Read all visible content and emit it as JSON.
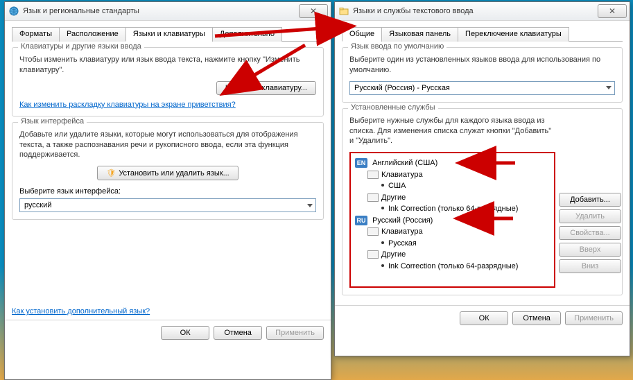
{
  "left": {
    "title": "Язык и региональные стандарты",
    "tabs": [
      "Форматы",
      "Расположение",
      "Языки и клавиатуры",
      "Дополнительно"
    ],
    "active_tab": 2,
    "group1": {
      "legend": "Клавиатуры и другие языки ввода",
      "desc": "Чтобы изменить клавиатуру или язык ввода текста, нажмите кнопку \"Изменить клавиатуру\".",
      "btn": "Изменить клавиатуру...",
      "link": "Как изменить раскладку клавиатуры на экране приветствия?"
    },
    "group2": {
      "legend": "Язык интерфейса",
      "desc": "Добавьте или удалите языки, которые могут использоваться для отображения текста, а также распознавания речи и рукописного ввода, если эта функция поддерживается.",
      "btn": "Установить или удалить язык...",
      "label": "Выберите язык интерфейса:",
      "value": "русский"
    },
    "link_bottom": "Как установить дополнительный язык?",
    "buttons": {
      "ok": "ОК",
      "cancel": "Отмена",
      "apply": "Применить"
    }
  },
  "right": {
    "title": "Языки и службы текстового ввода",
    "tabs": [
      "Общие",
      "Языковая панель",
      "Переключение клавиатуры"
    ],
    "active_tab": 0,
    "group1": {
      "legend": "Язык ввода по умолчанию",
      "desc": "Выберите один из установленных языков ввода для использования по умолчанию.",
      "value": "Русский (Россия) - Русская"
    },
    "group2": {
      "legend": "Установленные службы",
      "desc": "Выберите нужные службы для каждого языка ввода из списка. Для изменения списка служат кнопки \"Добавить\" и \"Удалить\".",
      "en_label": "Английский (США)",
      "ru_label": "Русский (Россия)",
      "kbd": "Клавиатура",
      "en_layout": "США",
      "ru_layout": "Русская",
      "other": "Другие",
      "ink": "Ink Correction (только 64-разрядные)"
    },
    "side_buttons": {
      "add": "Добавить...",
      "remove": "Удалить",
      "props": "Свойства...",
      "up": "Вверх",
      "down": "Вниз"
    },
    "buttons": {
      "ok": "ОК",
      "cancel": "Отмена",
      "apply": "Применить"
    }
  }
}
